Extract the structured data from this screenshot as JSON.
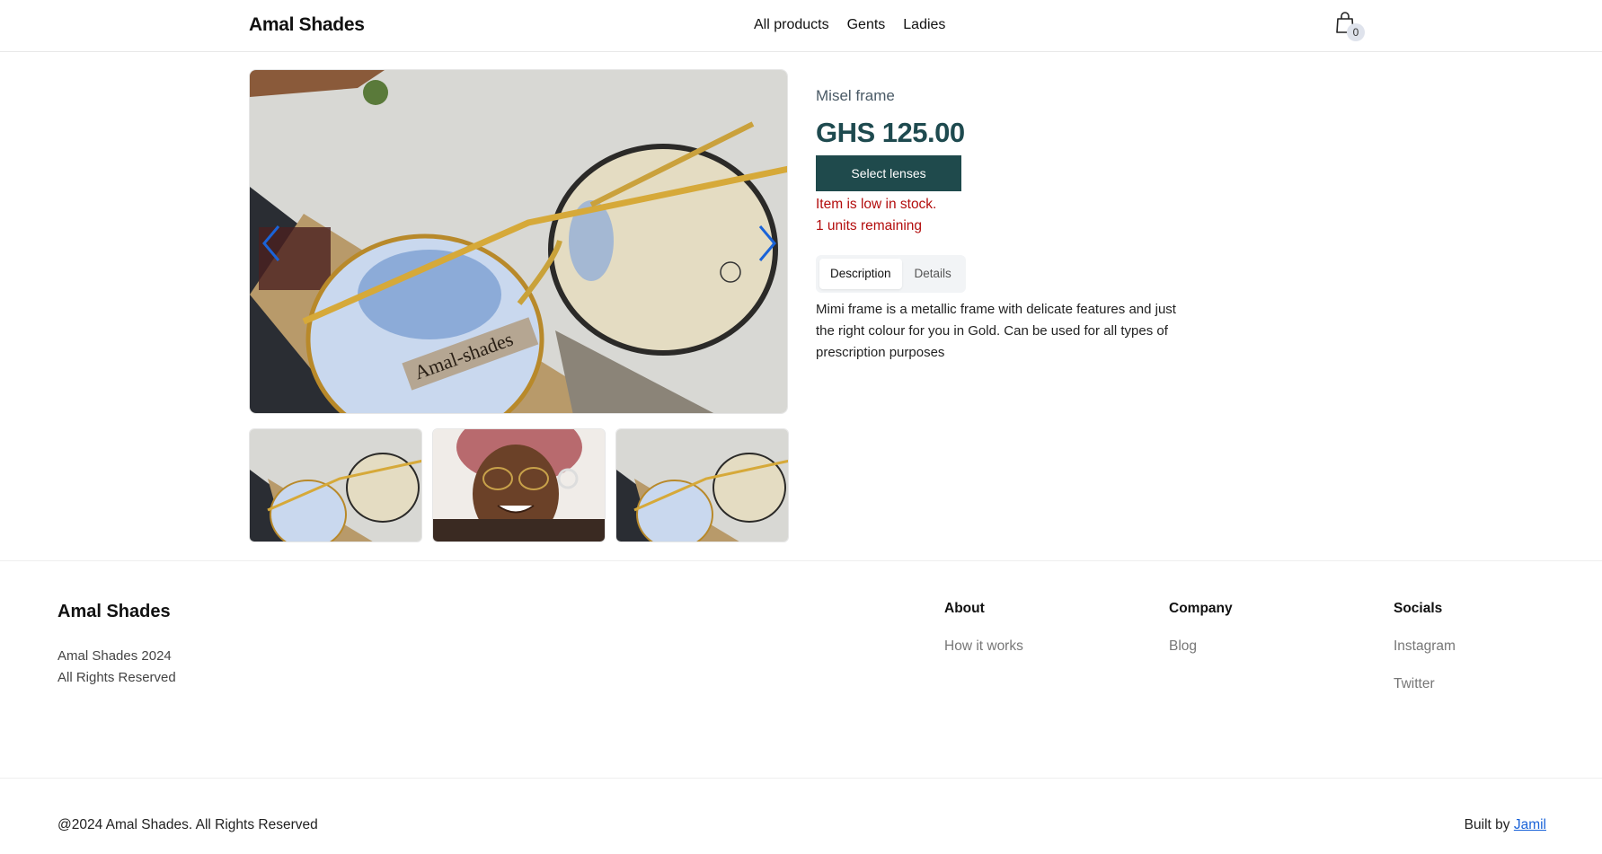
{
  "header": {
    "brand": "Amal Shades",
    "nav": [
      "All products",
      "Gents",
      "Ladies"
    ],
    "cart_count": "0",
    "cart_icon": "shopping-bag-icon"
  },
  "product": {
    "name": "Misel frame",
    "price": "GHS 125.00",
    "select_label": "Select lenses",
    "stock_warning": "Item is low in stock.",
    "units_remaining": "1 units remaining",
    "tabs": [
      "Description",
      "Details"
    ],
    "active_tab": "Description",
    "description": "Mimi frame is a metallic frame with delicate features and just the right colour for you in Gold. Can be used for all types of prescription purposes",
    "image_watermark": "Amal-shades",
    "carousel_icons": [
      "chevron-left-icon",
      "chevron-right-icon"
    ]
  },
  "footer": {
    "brand": "Amal Shades",
    "copy_line1": "Amal Shades 2024",
    "copy_line2": "All Rights Reserved",
    "columns": [
      {
        "title": "About",
        "links": [
          "How it works"
        ]
      },
      {
        "title": "Company",
        "links": [
          "Blog"
        ]
      },
      {
        "title": "Socials",
        "links": [
          "Instagram",
          "Twitter"
        ]
      }
    ],
    "bottom_left": "@2024 Amal Shades. All Rights Reserved",
    "built_by": "Built by",
    "author": "Jamil"
  },
  "colors": {
    "accent": "#1f4a4c",
    "price": "#1e4a4f",
    "warning": "#b30d0d",
    "link": "#1a63d8",
    "carousel_arrow": "#1a63d8"
  }
}
